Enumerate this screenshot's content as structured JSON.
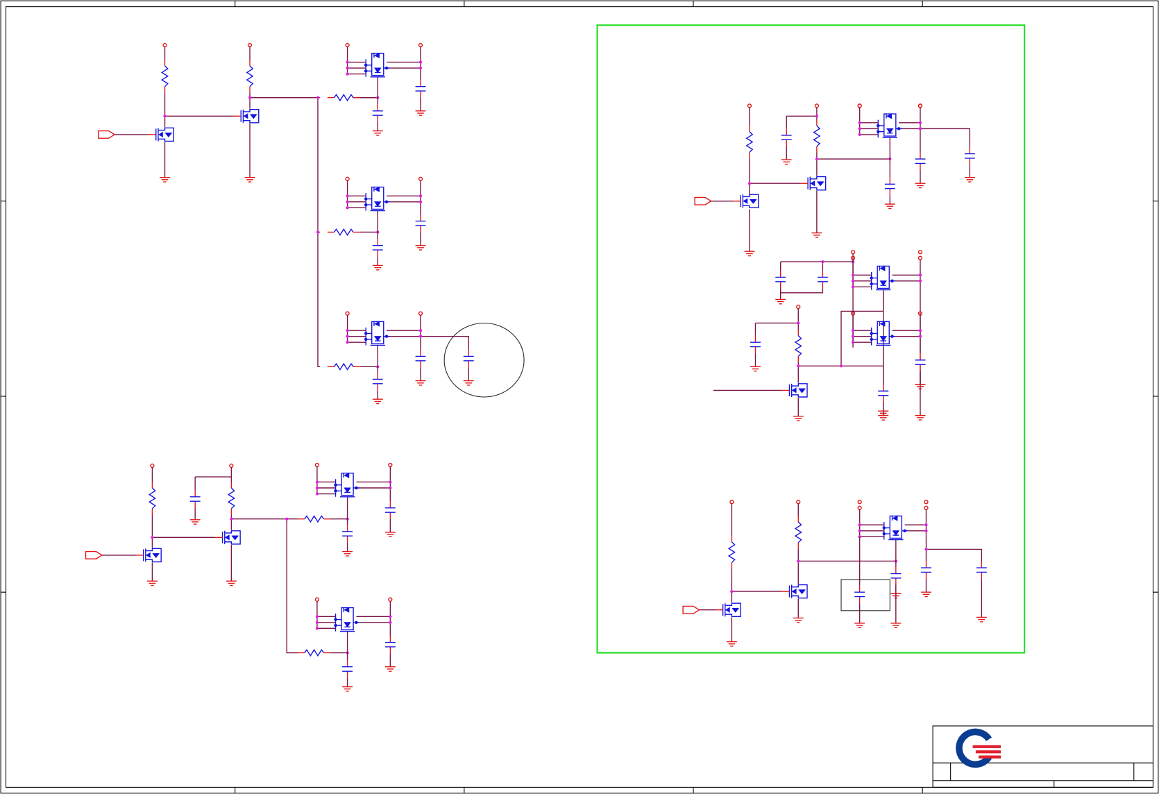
{
  "sheet": {
    "colors": {
      "wire": "#7a1446",
      "stub": "#e41414",
      "component": "#1414e0",
      "junction": "#e020e0",
      "highlight_box": "#22dd22",
      "border": "#000000",
      "logo_blue": "#0a3d91",
      "logo_red": "#e0202e"
    },
    "icons": [
      "resistor-symbol",
      "capacitor-symbol",
      "ground-symbol",
      "power-rail-symbol",
      "nmos-transistor-symbol",
      "power-mosfet-symbol",
      "input-port-symbol"
    ],
    "title_block": {
      "logo": "company-logo"
    }
  }
}
